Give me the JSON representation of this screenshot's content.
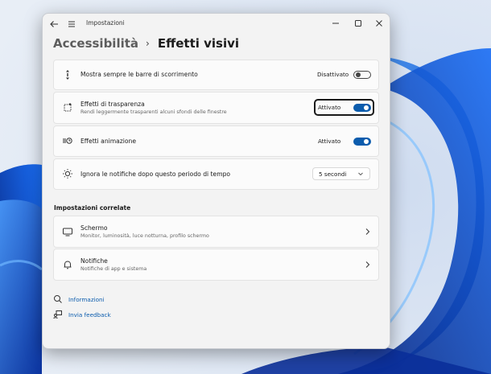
{
  "window": {
    "title": "Impostazioni"
  },
  "breadcrumb": {
    "parent": "Accessibilità",
    "separator": "›",
    "current": "Effetti visivi"
  },
  "settings": [
    {
      "title": "Mostra sempre le barre di scorrimento",
      "state_label": "Disattivato",
      "on": false,
      "icon": "scrollbar-icon"
    },
    {
      "title": "Effetti di trasparenza",
      "subtitle": "Rendi leggermente trasparenti alcuni sfondi delle finestre",
      "state_label": "Attivato",
      "on": true,
      "icon": "transparency-icon"
    },
    {
      "title": "Effetti animazione",
      "state_label": "Attivato",
      "on": true,
      "icon": "animation-icon"
    },
    {
      "title": "Ignora le notifiche dopo questo periodo di tempo",
      "dropdown_value": "5 secondi",
      "icon": "brightness-icon"
    }
  ],
  "related": {
    "heading": "Impostazioni correlate",
    "items": [
      {
        "title": "Schermo",
        "subtitle": "Monitor, luminosità, luce notturna, profilo schermo",
        "icon": "monitor-icon"
      },
      {
        "title": "Notifiche",
        "subtitle": "Notifiche di app e sistema",
        "icon": "bell-icon"
      }
    ]
  },
  "links": [
    {
      "label": "Informazioni",
      "icon": "help-icon"
    },
    {
      "label": "Invia feedback",
      "icon": "feedback-icon"
    }
  ],
  "colors": {
    "accent": "#0b5cad",
    "window_bg": "#f3f3f3",
    "card_bg": "#fbfbfb"
  }
}
